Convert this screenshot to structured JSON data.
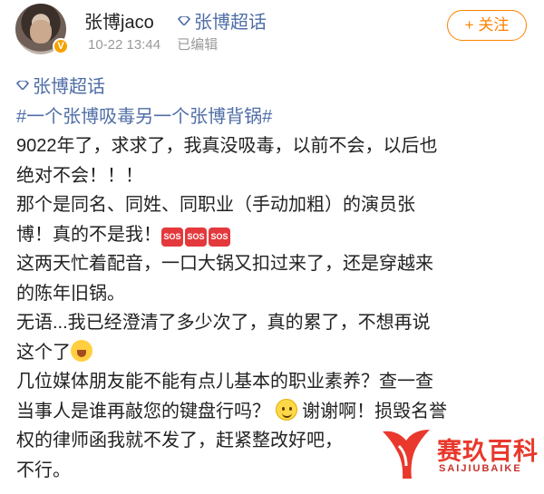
{
  "post": {
    "author": "张博jaco",
    "topic_link": "张博超话",
    "time": "10-22 13:44",
    "edited": "已编辑",
    "follow_label": "+ 关注",
    "verify_badge": "V"
  },
  "content": {
    "topic": "张博超话",
    "hashtag": "#一个张博吸毒另一个张博背锅#",
    "lines": {
      "p1a": "9022年了，求求了，我真没吸毒，以前不会，以后也",
      "p1b": "绝对不会！！！",
      "p2a": "那个是同名、同姓、同职业（手动加粗）的演员张",
      "p2b": "博！真的不是我！",
      "sos": "SOS",
      "p3a": "这两天忙着配音，一口大锅又扣过来了，还是穿越来",
      "p3b": "的陈年旧锅。",
      "p4a": "无语...我已经澄清了多少次了，真的累了，不想再说",
      "p4b": "这个了",
      "p5a": "几位媒体朋友能不能有点儿基本的职业素养？查一查",
      "p5b": "当事人是谁再敲您的键盘行吗？",
      "p5b_tail": "谢谢啊！损毁名誉",
      "p5c": "权的律师函我就不发了，赶紧整改好吧，",
      "p5d": "不行。"
    },
    "emojis": [
      "cry-emoji",
      "smile-emoji"
    ]
  },
  "watermark": {
    "title": "赛玖百科",
    "subtitle": "SAIJIUBAIKE",
    "brand_color": "#e8392c"
  },
  "colors": {
    "link": "#4f6ea6",
    "follow": "#ff8200",
    "text": "#222222",
    "meta": "#9a9a9a"
  }
}
